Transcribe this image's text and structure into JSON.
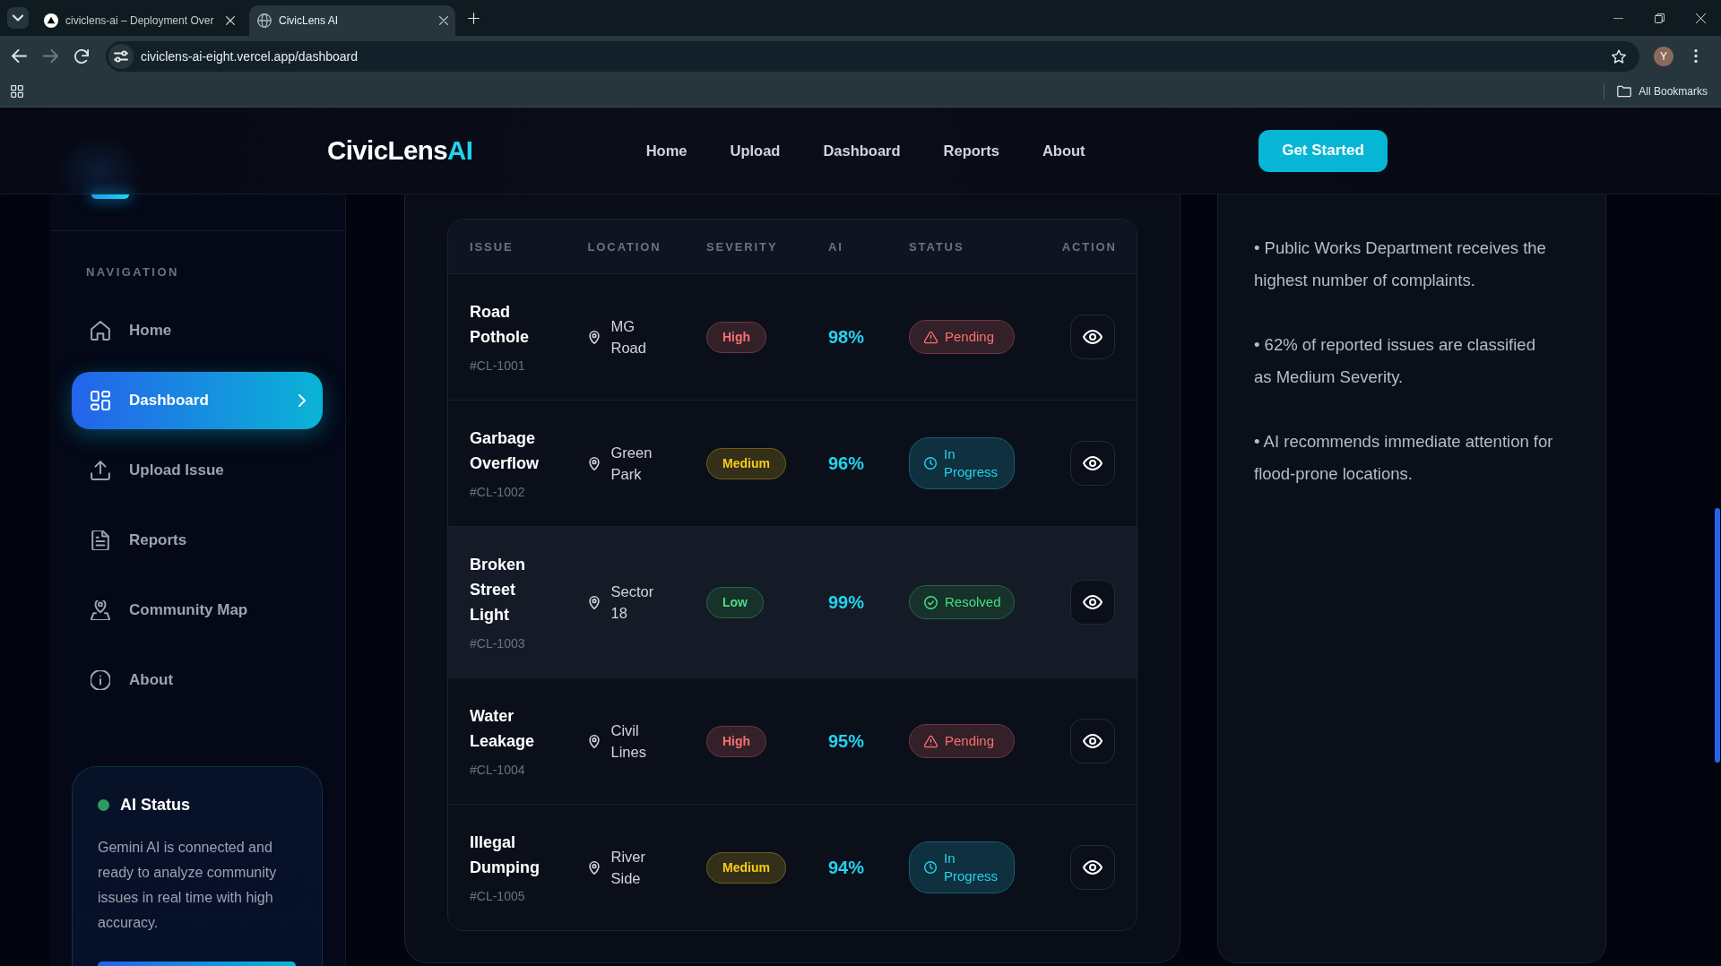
{
  "browser": {
    "tabs": [
      {
        "title": "civiclens-ai – Deployment Over",
        "selected": false
      },
      {
        "title": "CivicLens AI",
        "selected": true
      }
    ],
    "forward_disabled": true,
    "address": "civiclens-ai-eight.vercel.app/dashboard",
    "profile_initial": "Y",
    "bookmarks_label": "All Bookmarks"
  },
  "header": {
    "logo": {
      "text": "CivicLens",
      "accent": "AI"
    },
    "nav": [
      "Home",
      "Upload",
      "Dashboard",
      "Reports",
      "About"
    ],
    "cta": "Get Started"
  },
  "sidebar": {
    "section_label": "NAVIGATION",
    "items": [
      {
        "label": "Home",
        "selected": false
      },
      {
        "label": "Dashboard",
        "selected": true
      },
      {
        "label": "Upload Issue",
        "selected": false
      },
      {
        "label": "Reports",
        "selected": false
      },
      {
        "label": "Community Map",
        "selected": false
      },
      {
        "label": "About",
        "selected": false
      }
    ],
    "status_card": {
      "title": "AI Status",
      "online": true,
      "text": "Gemini AI is connected and ready to analyze community issues in real time with high accuracy."
    }
  },
  "table": {
    "columns": [
      "ISSUE",
      "LOCATION",
      "SEVERITY",
      "AI",
      "STATUS",
      "ACTION"
    ],
    "rows": [
      {
        "issue": "Road Pothole",
        "id": "#CL-1001",
        "location": "MG Road",
        "severity": {
          "label": "High",
          "kind": "high"
        },
        "ai": "98%",
        "status": {
          "label": "Pending",
          "kind": "pending"
        },
        "hovered": false
      },
      {
        "issue": "Garbage Overflow",
        "id": "#CL-1002",
        "location": "Green Park",
        "severity": {
          "label": "Medium",
          "kind": "medium"
        },
        "ai": "96%",
        "status": {
          "label": "In Progress",
          "kind": "in_progress"
        },
        "hovered": false
      },
      {
        "issue": "Broken Street Light",
        "id": "#CL-1003",
        "location": "Sector 18",
        "severity": {
          "label": "Low",
          "kind": "low"
        },
        "ai": "99%",
        "status": {
          "label": "Resolved",
          "kind": "resolved"
        },
        "hovered": true
      },
      {
        "issue": "Water Leakage",
        "id": "#CL-1004",
        "location": "Civil Lines",
        "severity": {
          "label": "High",
          "kind": "high"
        },
        "ai": "95%",
        "status": {
          "label": "Pending",
          "kind": "pending"
        },
        "hovered": false
      },
      {
        "issue": "Illegal Dumping",
        "id": "#CL-1005",
        "location": "River Side",
        "severity": {
          "label": "Medium",
          "kind": "medium"
        },
        "ai": "94%",
        "status": {
          "label": "In Progress",
          "kind": "in_progress"
        },
        "hovered": false
      }
    ]
  },
  "bullet_points": [
    "• Public Works Department receives the highest number of complaints.",
    "• 62% of reported issues are classified as Medium Severity.",
    "• AI recommends immediate attention for flood-prone locations."
  ]
}
